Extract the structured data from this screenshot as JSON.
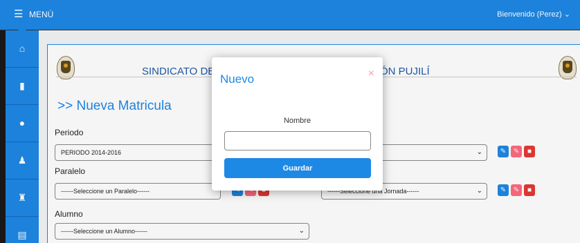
{
  "header": {
    "menu_icon": "hamburger-icon",
    "menu_label": "MENÚ",
    "welcome": "Bienvenido (Perez) ⌄"
  },
  "sidebar": {
    "items": [
      {
        "icon": "home-icon",
        "glyph": "⌂"
      },
      {
        "icon": "documents-icon",
        "glyph": "▮"
      },
      {
        "icon": "user-icon",
        "glyph": "●"
      },
      {
        "icon": "graduate-icon",
        "glyph": "♟"
      },
      {
        "icon": "users-icon",
        "glyph": "♜"
      },
      {
        "icon": "files-icon",
        "glyph": "▤"
      }
    ]
  },
  "org": {
    "title_left": "SINDICATO DE C",
    "title_right": "ÓN PUJILÍ"
  },
  "page": {
    "heading": ">> Nueva Matricula"
  },
  "form": {
    "periodo": {
      "label": "Periodo",
      "value": "PERIODO 2014-2016"
    },
    "paralelo": {
      "label": "Paralelo",
      "value": "------Seleccione un Paralelo------"
    },
    "jornada": {
      "value": "------Seleccione una Jornada------"
    },
    "alumno": {
      "label": "Alumno",
      "value": "------Seleccione un Alumno------"
    }
  },
  "modal": {
    "title": "Nuevo",
    "close": "×",
    "field_label": "Nombre",
    "field_value": "",
    "submit": "Guardar"
  },
  "colors": {
    "primary": "#1e88e5",
    "pink": "#ff6b81",
    "red": "#e53935"
  }
}
